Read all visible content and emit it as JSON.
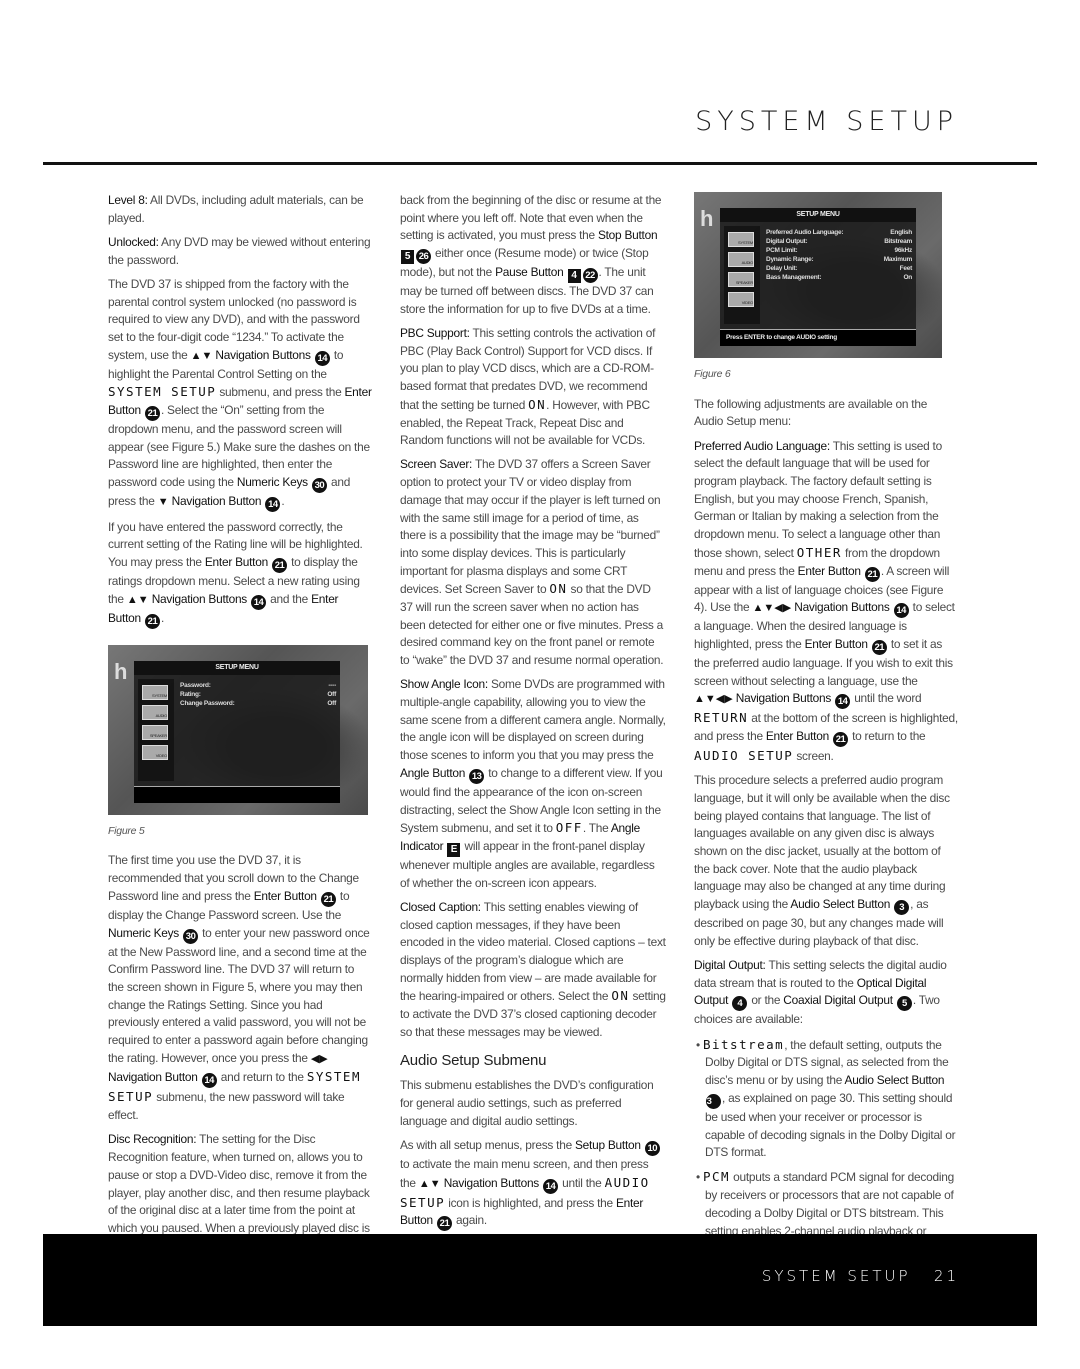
{
  "header": {
    "title": "SYSTEM SETUP"
  },
  "footer": {
    "section": "SYSTEM SETUP",
    "page_number": "21"
  },
  "figure5": {
    "caption": "Figure 5",
    "menu_title": "SETUP MENU",
    "icons": [
      "SYSTEM",
      "AUDIO",
      "SPEAKER",
      "VIDEO"
    ],
    "rows": [
      {
        "label": "Password:",
        "value": "----"
      },
      {
        "label": "Rating:",
        "value": "Off"
      },
      {
        "label": "Change Password:",
        "value": "Off"
      }
    ],
    "status": ""
  },
  "figure6": {
    "caption": "Figure 6",
    "menu_title": "SETUP MENU",
    "icons": [
      "SYSTEM",
      "AUDIO",
      "SPEAKER",
      "VIDEO"
    ],
    "rows": [
      {
        "label": "Preferred Audio Language:",
        "value": "English"
      },
      {
        "label": "Digital Output:",
        "value": "Bitstream"
      },
      {
        "label": "PCM Limit:",
        "value": "96kHz"
      },
      {
        "label": "Dynamic Range:",
        "value": "Maximum"
      },
      {
        "label": "Delay Unit:",
        "value": "Feet"
      },
      {
        "label": "Bass Management:",
        "value": "On"
      }
    ],
    "status": "Press ENTER to change AUDIO setting"
  },
  "col1": [
    {
      "kind": "p",
      "seg": [
        [
          "k",
          "Level 8:"
        ],
        [
          "n",
          " All DVDs, including adult materials, can be played."
        ]
      ]
    },
    {
      "kind": "p",
      "seg": [
        [
          "k",
          "Unlocked:"
        ],
        [
          "n",
          " Any DVD may be viewed without entering the password."
        ]
      ]
    },
    {
      "kind": "p",
      "seg": [
        [
          "n",
          "The DVD 37 is shipped from the factory with the parental control system unlocked (no password is required to view any DVD), and with the password set to the four-digit code “1234.” To activate the system, use the "
        ],
        [
          "a",
          "▲▼"
        ],
        [
          "n",
          " "
        ],
        [
          "k",
          "Navigation Buttons"
        ],
        [
          "n",
          " "
        ],
        [
          "c",
          "14"
        ],
        [
          "n",
          " to highlight the Parental Control Setting on the "
        ],
        [
          "m",
          "SYSTEM SETUP"
        ],
        [
          "n",
          " submenu, and press the "
        ],
        [
          "k",
          "Enter Button"
        ],
        [
          "n",
          " "
        ],
        [
          "c",
          "21"
        ],
        [
          "n",
          ". Select the “On” setting from the dropdown menu, and the password screen will appear (see Figure 5.) Make sure the dashes on the Password line are highlighted, then enter the password code using the "
        ],
        [
          "k",
          "Numeric Keys"
        ],
        [
          "n",
          " "
        ],
        [
          "c",
          "30"
        ],
        [
          "n",
          " and press the "
        ],
        [
          "a",
          "▼"
        ],
        [
          "n",
          " "
        ],
        [
          "k",
          "Navigation Button"
        ],
        [
          "n",
          " "
        ],
        [
          "c",
          "14"
        ],
        [
          "n",
          "."
        ]
      ]
    },
    {
      "kind": "p",
      "seg": [
        [
          "n",
          "If you have entered the password correctly, the current setting of the Rating line will be highlighted. You may press the "
        ],
        [
          "k",
          "Enter Button"
        ],
        [
          "n",
          " "
        ],
        [
          "c",
          "21"
        ],
        [
          "n",
          " to display the ratings dropdown menu. Select a new rating using the "
        ],
        [
          "a",
          "▲▼"
        ],
        [
          "n",
          " "
        ],
        [
          "k",
          "Navigation Buttons"
        ],
        [
          "n",
          " "
        ],
        [
          "c",
          "14"
        ],
        [
          "n",
          " and the "
        ],
        [
          "k",
          "Enter Button"
        ],
        [
          "n",
          " "
        ],
        [
          "c",
          "21"
        ],
        [
          "n",
          "."
        ]
      ]
    },
    {
      "kind": "fig5"
    },
    {
      "kind": "p",
      "seg": [
        [
          "n",
          "The first time you use the DVD 37, it is recommended that you scroll down to the Change Password line and press the "
        ],
        [
          "k",
          "Enter Button"
        ],
        [
          "n",
          " "
        ],
        [
          "c",
          "21"
        ],
        [
          "n",
          " to display the Change Password screen. Use the "
        ],
        [
          "k",
          "Numeric Keys"
        ],
        [
          "n",
          " "
        ],
        [
          "c",
          "30"
        ],
        [
          "n",
          " to enter your new password once at the New Password line, and a second time at the Confirm Password line. The DVD 37 will return to the screen shown in Figure 5, where you may then change the Ratings Setting. Since you had previously entered a valid password, you will not be required to enter a password again before changing the rating. However, once you press the "
        ],
        [
          "a",
          "◀▶"
        ],
        [
          "n",
          " "
        ],
        [
          "k",
          "Navigation Button"
        ],
        [
          "n",
          " "
        ],
        [
          "c",
          "14"
        ],
        [
          "n",
          " and return to the "
        ],
        [
          "m",
          "SYSTEM SETUP"
        ],
        [
          "n",
          " submenu, the new password will take effect."
        ]
      ]
    },
    {
      "kind": "p",
      "seg": [
        [
          "k",
          "Disc Recognition:"
        ],
        [
          "n",
          " The setting for the Disc Recognition feature, when turned on, allows you to pause or stop a DVD-Video disc, remove it from the player, play another disc, and then resume playback of the original disc at a later time from the point at which you paused. When a previously played disc is reinserted in the DVD 37, you will be presented with an on-screen status message asking whether you wish to start play-"
        ]
      ]
    }
  ],
  "col2": [
    {
      "kind": "p",
      "seg": [
        [
          "n",
          "back from the beginning of the disc or resume at the point where you left off. Note that even when the setting is activated, you must press the "
        ],
        [
          "k",
          "Stop Button"
        ],
        [
          "n",
          " "
        ],
        [
          "q",
          "5"
        ],
        [
          "c",
          "26"
        ],
        [
          "n",
          " either once (Resume mode) or twice (Stop mode), but not the "
        ],
        [
          "k",
          "Pause Button"
        ],
        [
          "n",
          " "
        ],
        [
          "q",
          "4"
        ],
        [
          "c",
          "22"
        ],
        [
          "n",
          ". The unit may be turned off between discs. The DVD 37 can store the information for up to five DVDs at a time."
        ]
      ]
    },
    {
      "kind": "p",
      "seg": [
        [
          "k",
          "PBC Support:"
        ],
        [
          "n",
          " This setting controls the activation of PBC (Play Back Control) Support for VCD discs. If you plan to play VCD discs, which are a CD-ROM-based format that predates DVD, we recommend that the setting be turned "
        ],
        [
          "m",
          "ON"
        ],
        [
          "n",
          ". However, with PBC enabled, the Repeat Track, Repeat Disc and Random functions will not be available for VCDs."
        ]
      ]
    },
    {
      "kind": "p",
      "seg": [
        [
          "k",
          "Screen Saver:"
        ],
        [
          "n",
          " The DVD 37 offers a Screen Saver option to protect your TV or video display from damage that may occur if the player is left turned on with the same still image for a period of time, as there is a possibility that the image may be “burned” into some display devices. This is particularly important for plasma displays and some CRT devices. Set Screen Saver to "
        ],
        [
          "m",
          "ON"
        ],
        [
          "n",
          " so that the DVD 37 will run the screen saver when no action has been detected for either one or five minutes. Press a desired command key on the front panel or remote to “wake” the DVD 37 and resume normal operation."
        ]
      ]
    },
    {
      "kind": "p",
      "seg": [
        [
          "k",
          "Show Angle Icon:"
        ],
        [
          "n",
          " Some DVDs are programmed with multiple-angle capability, allowing you to view the same scene from a different camera angle. Normally, the angle icon will be displayed on screen during those scenes to inform you that you may press the "
        ],
        [
          "k",
          "Angle Button"
        ],
        [
          "n",
          " "
        ],
        [
          "c",
          "13"
        ],
        [
          "n",
          " to change to a different view. If you would find the appearance of the icon on-screen distracting, select the Show Angle Icon setting in the System submenu, and set it to "
        ],
        [
          "m",
          "OFF"
        ],
        [
          "n",
          ". The "
        ],
        [
          "k",
          "Angle Indicator"
        ],
        [
          "n",
          " "
        ],
        [
          "q",
          "E"
        ],
        [
          "n",
          " will appear in the front-panel display whenever multiple angles are available, regardless of whether the on-screen icon appears."
        ]
      ]
    },
    {
      "kind": "p",
      "seg": [
        [
          "k",
          "Closed Caption:"
        ],
        [
          "n",
          " This setting enables viewing of closed caption messages, if they have been encoded in the video material. Closed captions – text displays of the program’s dialogue which are normally hidden from view – are made available for the hearing-impaired or others. Select the "
        ],
        [
          "m",
          "ON"
        ],
        [
          "n",
          " setting to activate the DVD 37’s closed captioning decoder so that these messages may be viewed."
        ]
      ]
    },
    {
      "kind": "h",
      "text": "Audio Setup Submenu"
    },
    {
      "kind": "p",
      "seg": [
        [
          "n",
          "This submenu establishes the DVD’s configuration for general audio settings, such as preferred language and digital audio settings."
        ]
      ]
    },
    {
      "kind": "p",
      "seg": [
        [
          "n",
          "As with all setup menus, press the "
        ],
        [
          "k",
          "Setup Button"
        ],
        [
          "n",
          " "
        ],
        [
          "c",
          "10"
        ],
        [
          "n",
          " to activate the main menu screen, and then press the "
        ],
        [
          "a",
          "▲▼"
        ],
        [
          "n",
          " "
        ],
        [
          "k",
          "Navigation Buttons"
        ],
        [
          "n",
          " "
        ],
        [
          "c",
          "14"
        ],
        [
          "n",
          " until the "
        ],
        [
          "m",
          "AUDIO SETUP"
        ],
        [
          "n",
          " icon is highlighted, and press the "
        ],
        [
          "k",
          "Enter Button"
        ],
        [
          "n",
          " "
        ],
        [
          "c",
          "21"
        ],
        [
          "n",
          " again."
        ]
      ]
    }
  ],
  "col3": [
    {
      "kind": "fig6"
    },
    {
      "kind": "p",
      "seg": [
        [
          "n",
          "The following adjustments are available on the Audio Setup menu:"
        ]
      ]
    },
    {
      "kind": "p",
      "seg": [
        [
          "k",
          "Preferred Audio Language:"
        ],
        [
          "n",
          " This setting is used to select the default language that will be used for program playback. The factory default setting is English, but you may choose French, Spanish, German or Italian by making a selection from the dropdown menu. To select a language other than those shown, select "
        ],
        [
          "m",
          "OTHER"
        ],
        [
          "n",
          " from the dropdown menu and press the "
        ],
        [
          "k",
          "Enter Button"
        ],
        [
          "n",
          " "
        ],
        [
          "c",
          "21"
        ],
        [
          "n",
          ". A screen will appear with a list of language choices (see Figure 4). Use the "
        ],
        [
          "a",
          "▲▼◀▶"
        ],
        [
          "n",
          " "
        ],
        [
          "k",
          "Navigation Buttons"
        ],
        [
          "n",
          " "
        ],
        [
          "c",
          "14"
        ],
        [
          "n",
          " to select a language. When the desired language is highlighted, press the "
        ],
        [
          "k",
          "Enter Button"
        ],
        [
          "n",
          " "
        ],
        [
          "c",
          "21"
        ],
        [
          "n",
          " to set it as the preferred audio language. If you wish to exit this screen without selecting a language, use the "
        ],
        [
          "a",
          "▲▼◀▶"
        ],
        [
          "n",
          " "
        ],
        [
          "k",
          "Navigation Buttons"
        ],
        [
          "n",
          " "
        ],
        [
          "c",
          "14"
        ],
        [
          "n",
          " until the word "
        ],
        [
          "m",
          "RETURN"
        ],
        [
          "n",
          " at the bottom of the screen is highlighted, and press the "
        ],
        [
          "k",
          "Enter Button"
        ],
        [
          "n",
          " "
        ],
        [
          "c",
          "21"
        ],
        [
          "n",
          " to return to the "
        ],
        [
          "m",
          "AUDIO SETUP"
        ],
        [
          "n",
          " screen."
        ]
      ]
    },
    {
      "kind": "p",
      "seg": [
        [
          "n",
          "This procedure selects a preferred audio program language, but it will only be available when the disc being played contains that language. The list of languages available on any given disc is always shown on the disc jacket, usually at the bottom of the back cover. Note that the audio playback language may also be changed at any time during playback using the "
        ],
        [
          "k",
          "Audio Select Button"
        ],
        [
          "n",
          " "
        ],
        [
          "c",
          "3"
        ],
        [
          "n",
          ", as described on page 30, but any changes made will only be effective during playback of that disc."
        ]
      ]
    },
    {
      "kind": "p",
      "seg": [
        [
          "k",
          "Digital Output:"
        ],
        [
          "n",
          " This setting selects the digital audio data stream that is routed to the "
        ],
        [
          "k",
          "Optical Digital Output"
        ],
        [
          "n",
          " "
        ],
        [
          "c",
          "4"
        ],
        [
          "n",
          " or the "
        ],
        [
          "k",
          "Coaxial Digital Output"
        ],
        [
          "n",
          " "
        ],
        [
          "c",
          "5"
        ],
        [
          "n",
          ". Two choices are available:"
        ]
      ]
    },
    {
      "kind": "b",
      "seg": [
        [
          "n",
          "• "
        ],
        [
          "m",
          "Bitstream"
        ],
        [
          "n",
          ", the default setting, outputs the Dolby Digital or DTS signal, as selected from the disc’s menu or by using the "
        ],
        [
          "k",
          "Audio Select Button"
        ],
        [
          "n",
          " "
        ],
        [
          "c",
          "3"
        ],
        [
          "n",
          ", as explained on page 30. This setting should be used when your receiver or processor is capable of decoding signals in the Dolby Digital or DTS format."
        ]
      ]
    },
    {
      "kind": "b",
      "seg": [
        [
          "n",
          "• "
        ],
        [
          "m",
          "PCM"
        ],
        [
          "n",
          " outputs a standard PCM signal for decoding by receivers or processors that are not capable of decoding a Dolby Digital or DTS bitstream. This setting enables 2-channel audio playback or matrix decoding where available."
        ]
      ]
    }
  ]
}
